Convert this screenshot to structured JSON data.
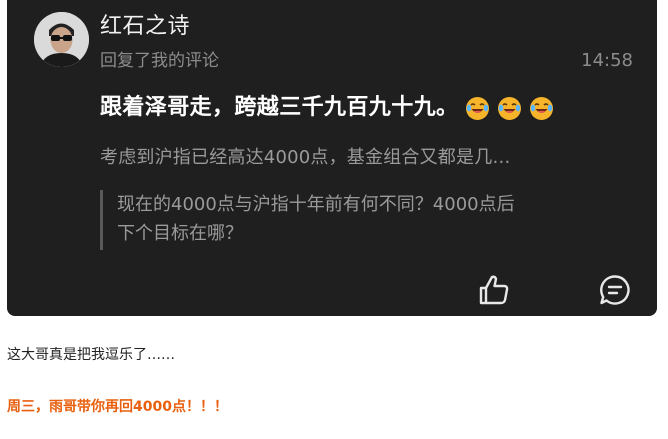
{
  "comment": {
    "username": "红石之诗",
    "action_text": "回复了我的评论",
    "time": "14:58",
    "reply_text": "跟着泽哥走，跨越三千九百九十九。",
    "reply_emojis": [
      "laughing-crying-emoji",
      "laughing-crying-emoji",
      "laughing-crying-emoji"
    ],
    "my_comment": "考虑到沪指已经高达4000点，基金组合又都是几…",
    "quoted_line_1": "现在的4000点与沪指十年前有何不同？4000点后",
    "quoted_line_2": "下个目标在哪？",
    "actions": [
      "thumbs-up-icon",
      "comment-icon"
    ]
  },
  "article": {
    "caption": "这大哥真是把我逗乐了……",
    "highlight": "周三，雨哥带你再回4000点！！！",
    "highlight_color": "#e8600f"
  },
  "colors": {
    "card_bg": "#1f1f1f",
    "primary_text": "#ffffff",
    "secondary_text": "#8c8c8c",
    "quote_text": "#9a9a9a",
    "quote_bar": "#5a5a5a"
  }
}
